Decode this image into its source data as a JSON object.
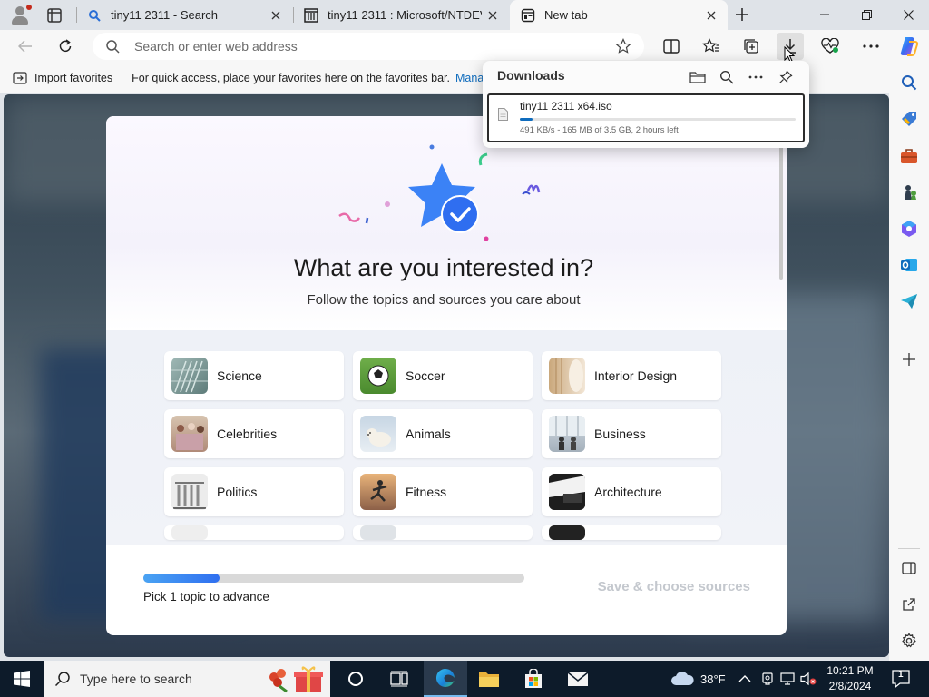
{
  "browser": {
    "tabs": [
      {
        "title": "tiny11 2311 - Search",
        "icon": "search-icon",
        "active": false
      },
      {
        "title": "tiny11 2311 : Microsoft/NTDEV :",
        "icon": "archive-icon",
        "active": false
      },
      {
        "title": "New tab",
        "icon": "newtab-icon",
        "active": true
      }
    ],
    "address": {
      "placeholder": "Search or enter web address",
      "value": ""
    },
    "favorites_bar": {
      "import_label": "Import favorites",
      "quick_text": "For quick access, place your favorites here on the favorites bar.",
      "manage_link": "Manage favorites now"
    }
  },
  "downloads": {
    "title": "Downloads",
    "item": {
      "filename": "tiny11 2311 x64.iso",
      "status": "491 KB/s - 165 MB of 3.5 GB, 2 hours left",
      "progress": 0.046
    }
  },
  "modal": {
    "title": "What are you interested in?",
    "subtitle": "Follow the topics and sources you care about",
    "topics": [
      {
        "label": "Science",
        "thumb": "science"
      },
      {
        "label": "Soccer",
        "thumb": "soccer"
      },
      {
        "label": "Interior Design",
        "thumb": "interior"
      },
      {
        "label": "Celebrities",
        "thumb": "celebrities"
      },
      {
        "label": "Animals",
        "thumb": "animals"
      },
      {
        "label": "Business",
        "thumb": "business"
      },
      {
        "label": "Politics",
        "thumb": "politics"
      },
      {
        "label": "Fitness",
        "thumb": "fitness"
      },
      {
        "label": "Architecture",
        "thumb": "architecture"
      }
    ],
    "progress_fraction": 0.2,
    "progress_text": "Pick 1 topic to advance",
    "save_button": "Save & choose sources"
  },
  "taskbar": {
    "search_placeholder": "Type here to search",
    "weather": "38°F",
    "time": "10:21 PM",
    "date": "2/8/2024",
    "notification_count": "1"
  },
  "colors": {
    "accent": "#0f6cbd",
    "progress_start": "#4aa3f3",
    "progress_end": "#2f6ff0",
    "taskbar": "#0d1b2a"
  }
}
